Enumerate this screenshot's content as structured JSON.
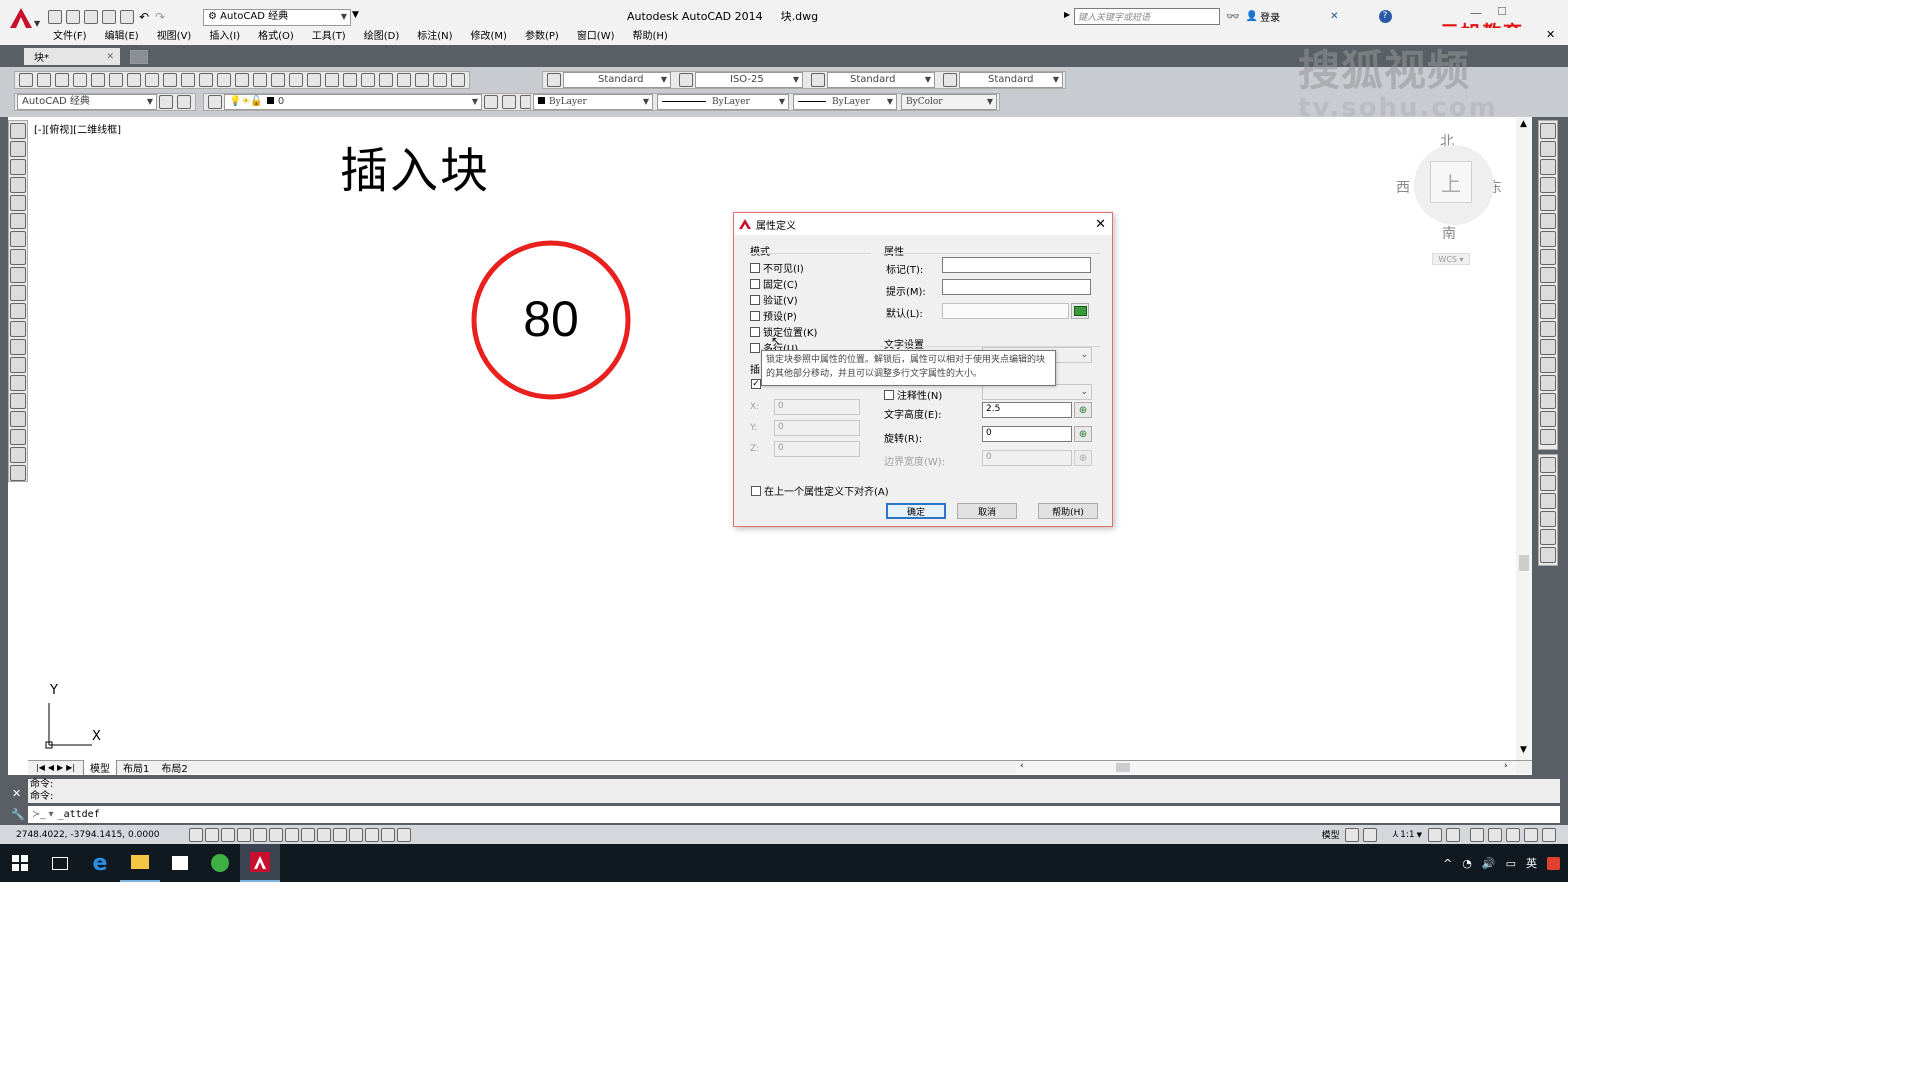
{
  "title_bar": {
    "app_title": "Autodesk AutoCAD 2014",
    "file_name": "块.dwg",
    "workspace": "AutoCAD 经典",
    "search_placeholder": "键入关键字或短语",
    "login": "登录",
    "watermark_brand": "元旭教育",
    "watermark_sohu": "搜狐视频",
    "watermark_url": "tv.sohu.com"
  },
  "menu": [
    "文件(F)",
    "编辑(E)",
    "视图(V)",
    "插入(I)",
    "格式(O)",
    "工具(T)",
    "绘图(D)",
    "标注(N)",
    "修改(M)",
    "参数(P)",
    "窗口(W)",
    "帮助(H)"
  ],
  "doc_tab": "块*",
  "styles": {
    "text_style": "Standard",
    "dim_style": "ISO-25",
    "table_style": "Standard",
    "mleader_style": "Standard"
  },
  "props": {
    "workspace": "AutoCAD 经典",
    "layer": "0",
    "color": "ByLayer",
    "linetype": "ByLayer",
    "lineweight": "ByLayer",
    "plotstyle": "ByColor"
  },
  "viewport_label": "[-][俯视][二维线框]",
  "drawing": {
    "title": "插入块",
    "circle_text": "80",
    "circle_color": "#e8201e"
  },
  "viewcube": {
    "north": "北",
    "south": "南",
    "east": "东",
    "west": "西",
    "face": "上",
    "wcs": "WCS"
  },
  "ucs": {
    "x": "X",
    "y": "Y"
  },
  "dialog": {
    "title": "属性定义",
    "mode_title": "模式",
    "modes": [
      "不可见(I)",
      "固定(C)",
      "验证(V)",
      "预设(P)",
      "锁定位置(K)",
      "多行(U)"
    ],
    "insert_prefix": "插",
    "xyz": [
      {
        "label": "X:",
        "value": "0"
      },
      {
        "label": "Y:",
        "value": "0"
      },
      {
        "label": "Z:",
        "value": "0"
      }
    ],
    "attr_title": "属性",
    "tag_label": "标记(T):",
    "prompt_label": "提示(M):",
    "default_label": "默认(L):",
    "text_title": "文字设置",
    "annotative": "注释性(N)",
    "height_label": "文字高度(E):",
    "height_value": "2.5",
    "rotation_label": "旋转(R):",
    "rotation_value": "0",
    "boundary_label": "边界宽度(W):",
    "boundary_value": "0",
    "align_prev": "在上一个属性定义下对齐(A)",
    "ok": "确定",
    "cancel": "取消",
    "help": "帮助(H)",
    "tooltip": "锁定块参照中属性的位置。解锁后，属性可以相对于使用夹点编辑的块的其他部分移动，并且可以调整多行文字属性的大小。"
  },
  "layout_tabs": [
    "模型",
    "布局1",
    "布局2"
  ],
  "command": {
    "history": [
      "命令:",
      "命令:"
    ],
    "current": "_attdef"
  },
  "status": {
    "coords": "2748.4022, -3794.1415, 0.0000",
    "model": "模型",
    "scale": "1:1"
  },
  "taskbar": {
    "ime": "英"
  }
}
